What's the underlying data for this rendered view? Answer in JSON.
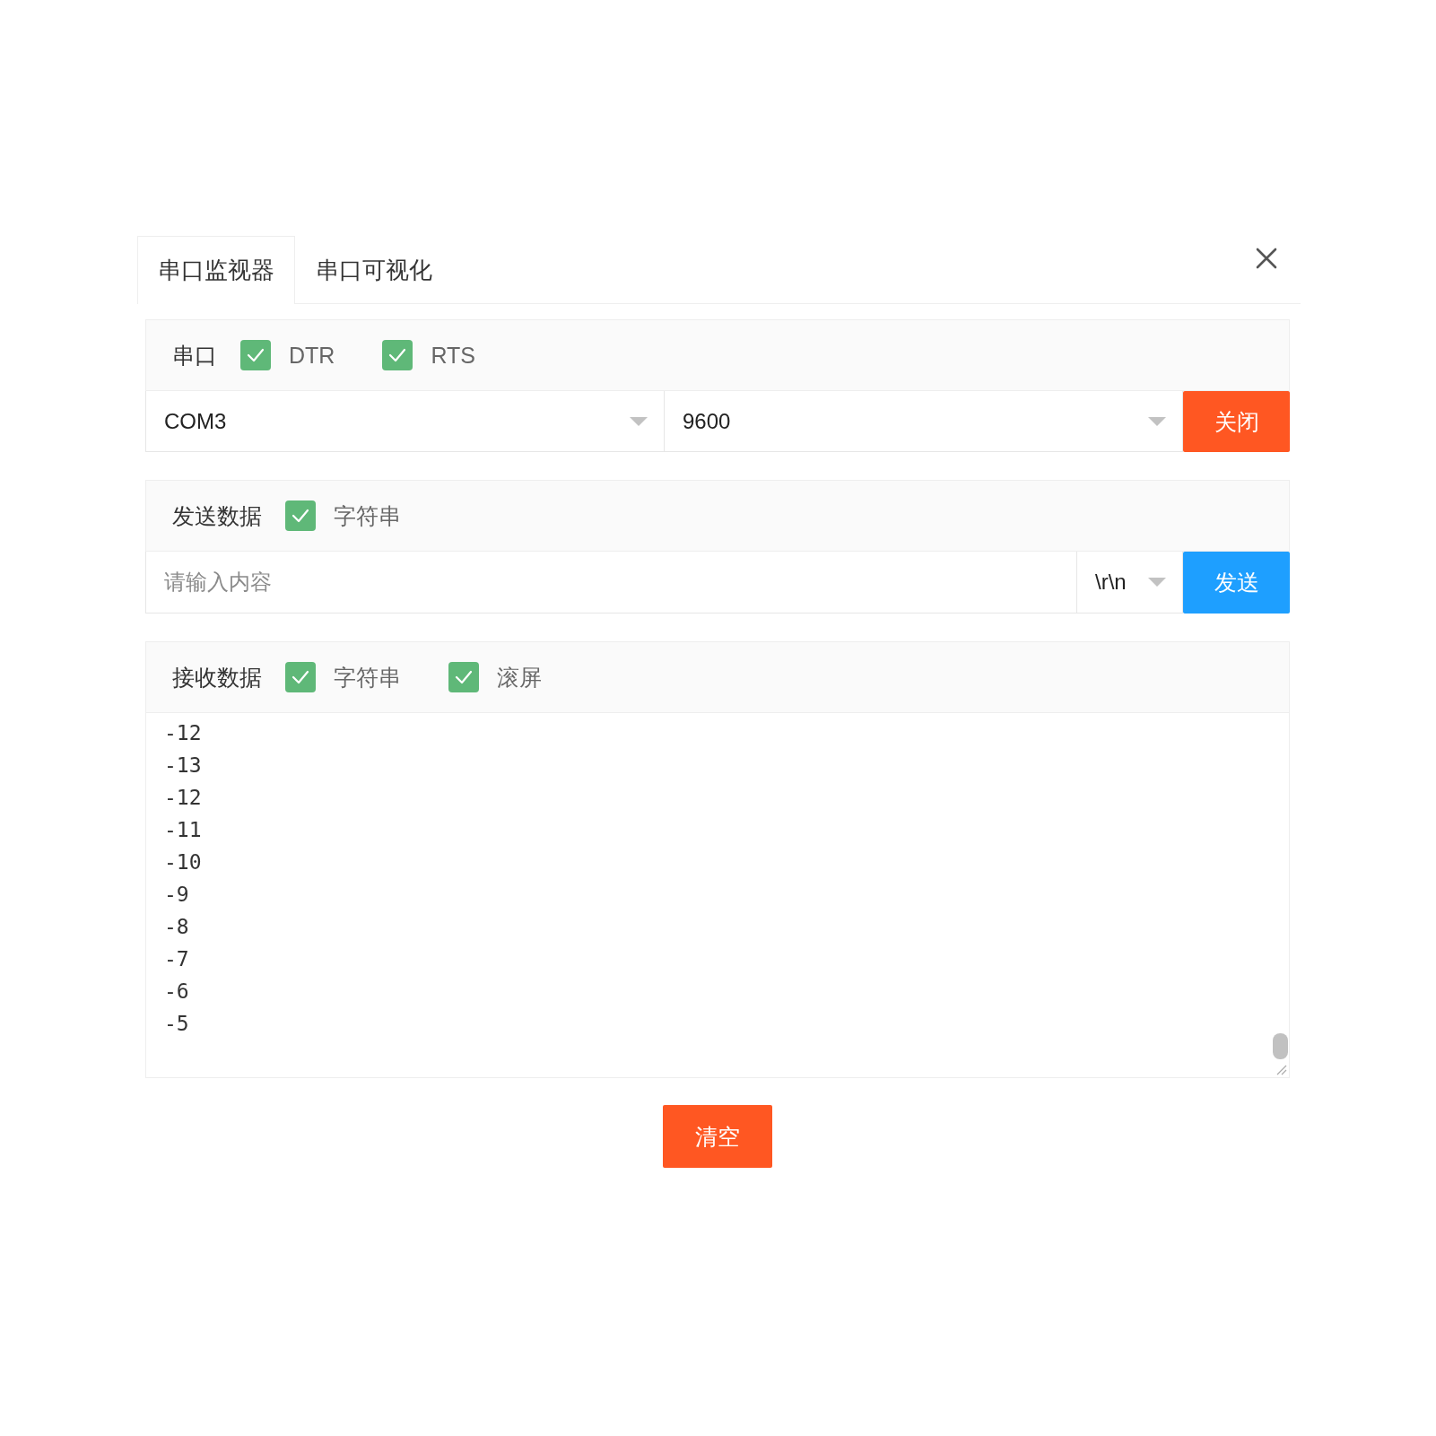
{
  "tabs": [
    {
      "label": "串口监视器",
      "selected": true
    },
    {
      "label": "串口可视化",
      "selected": false
    }
  ],
  "serial": {
    "title": "串口",
    "options": [
      {
        "label": "DTR",
        "checked": true
      },
      {
        "label": "RTS",
        "checked": true
      }
    ],
    "port": {
      "value": "COM3"
    },
    "baud_rate": {
      "value": "9600"
    },
    "button": "关闭"
  },
  "send": {
    "title": "发送数据",
    "options": [
      {
        "label": "字符串",
        "checked": true
      }
    ],
    "input": {
      "placeholder": "请输入内容"
    },
    "line_ending": {
      "value": "\\r\\n"
    },
    "button": "发送"
  },
  "receive": {
    "title": "接收数据",
    "options": [
      {
        "label": "字符串",
        "checked": true
      },
      {
        "label": "滚屏",
        "checked": true
      }
    ],
    "lines": [
      "-12",
      "-13",
      "-12",
      "-11",
      "-10",
      "-9",
      "-8",
      "-7",
      "-6",
      "-5"
    ]
  },
  "clear_button": "清空"
}
